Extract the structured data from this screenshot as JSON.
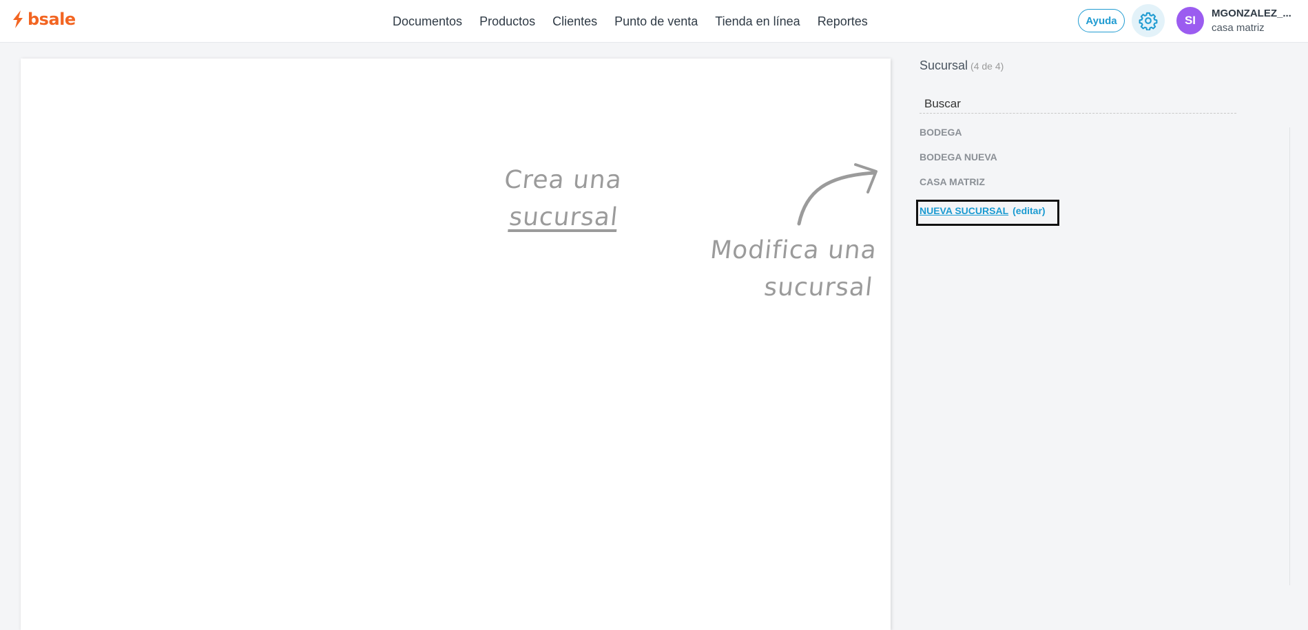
{
  "brand": {
    "name": "bsale",
    "color": "#f26522"
  },
  "nav": {
    "items": [
      "Documentos",
      "Productos",
      "Clientes",
      "Punto de venta",
      "Tienda en línea",
      "Reportes"
    ]
  },
  "header": {
    "help_label": "Ayuda",
    "settings_icon": "gear-icon",
    "avatar_initials": "SI",
    "user_name": "MGONZALEZ_...",
    "user_branch": "casa matriz",
    "accent_color": "#1f9bd1",
    "avatar_color": "#9b5cf0"
  },
  "canvas": {
    "create_hint_line1": "Crea una",
    "create_hint_line2": "sucursal",
    "modify_hint_line1": "Modifica una",
    "modify_hint_line2": "sucursal"
  },
  "panel": {
    "title": "Sucursal",
    "count": "(4 de 4)",
    "search_placeholder": "Buscar",
    "branches": [
      {
        "name": "BODEGA"
      },
      {
        "name": "BODEGA NUEVA"
      },
      {
        "name": "CASA MATRIZ"
      },
      {
        "name": "NUEVA SUCURSAL",
        "edit": "(editar)",
        "selected": true
      }
    ]
  }
}
